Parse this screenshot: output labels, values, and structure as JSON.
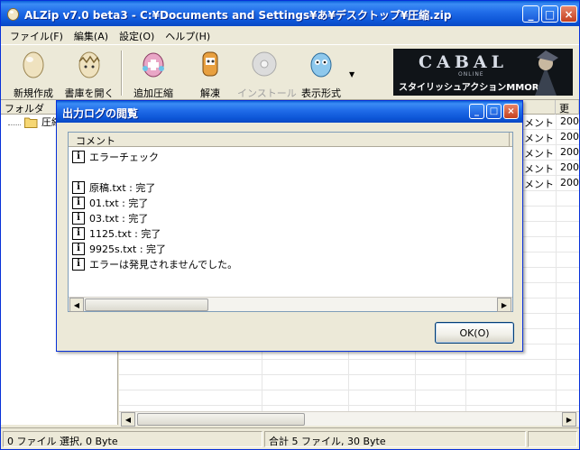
{
  "window": {
    "title": "ALZip v7.0 beta3 - C:¥Documents and Settings¥あ¥デスクトップ¥圧縮.zip"
  },
  "menu": [
    "ファイル(F)",
    "編集(A)",
    "設定(O)",
    "ヘルプ(H)"
  ],
  "toolbar": {
    "new": "新規作成",
    "open": "書庫を開く",
    "add": "追加圧縮",
    "extract": "解凍",
    "install": "インストール",
    "view": "表示形式"
  },
  "banner": {
    "logo": "CABAL",
    "sub": "ONLINE",
    "tagline": "スタイリッシュアクションMMORPG"
  },
  "folder_pane": {
    "header": "フォルダ",
    "item": "圧縮"
  },
  "file_pane": {
    "col_more": "更",
    "rows": [
      {
        "comment": "メント",
        "date": "200"
      },
      {
        "comment": "メント",
        "date": "200"
      },
      {
        "comment": "メント",
        "date": "200"
      },
      {
        "comment": "メント",
        "date": "200"
      },
      {
        "comment": "メント",
        "date": "200"
      }
    ]
  },
  "status": {
    "left": "0 ファイル 選択,  0 Byte",
    "right": "合計 5 ファイル,  30 Byte"
  },
  "dialog": {
    "title": "出力ログの閲覧",
    "column": "コメント",
    "lines": [
      "エラーチェック",
      "",
      "原稿.txt : 完了",
      "01.txt : 完了",
      "03.txt : 完了",
      "1125.txt : 完了",
      "9925s.txt : 完了",
      "エラーは発見されませんでした。"
    ],
    "info_glyph": "i",
    "ok": "OK(O)"
  },
  "colors": {
    "titlebar": "#0a5fd8",
    "face": "#ece9d8"
  },
  "icons": [
    "app-icon",
    "egg-icon",
    "open-egg-icon",
    "add-compress-icon",
    "extract-icon",
    "install-disc-icon",
    "view-format-icon",
    "folder-icon",
    "info-icon"
  ]
}
